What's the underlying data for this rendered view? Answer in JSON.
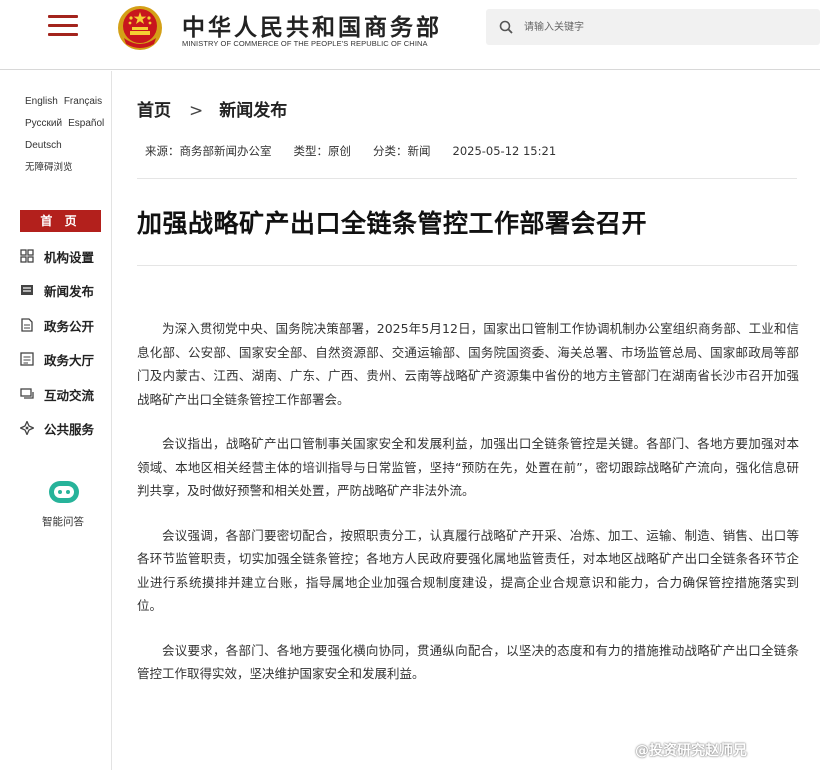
{
  "header": {
    "site_title": "中华人民共和国商务部",
    "site_subtitle": "MINISTRY OF COMMERCE OF THE PEOPLE'S REPUBLIC OF CHINA",
    "search_placeholder": "请输入关键字",
    "menu_icon": "hamburger-menu-icon",
    "emblem_icon": "national-emblem-icon",
    "search_icon": "search-icon"
  },
  "sidebar": {
    "languages": [
      "English",
      "Français",
      "Русский",
      "Español",
      "Deutsch",
      "无障碍浏览"
    ],
    "home": "首 页",
    "nav": [
      {
        "label": "机构设置",
        "icon": "grid-icon"
      },
      {
        "label": "新闻发布",
        "icon": "news-icon"
      },
      {
        "label": "政务公开",
        "icon": "document-icon"
      },
      {
        "label": "政务大厅",
        "icon": "hall-icon"
      },
      {
        "label": "互动交流",
        "icon": "chat-icon"
      },
      {
        "label": "公共服务",
        "icon": "service-icon"
      }
    ],
    "ai_label": "智能问答",
    "ai_icon": "robot-icon"
  },
  "breadcrumb": {
    "home": "首页",
    "sep": ">",
    "current": "新闻发布"
  },
  "meta": {
    "source": "来源：商务部新闻办公室",
    "type": "类型：原创",
    "category": "分类：新闻",
    "datetime": "2025-05-12 15:21"
  },
  "article": {
    "title": "加强战略矿产出口全链条管控工作部署会召开",
    "paragraphs": [
      "为深入贯彻党中央、国务院决策部署，2025年5月12日，国家出口管制工作协调机制办公室组织商务部、工业和信息化部、公安部、国家安全部、自然资源部、交通运输部、国务院国资委、海关总署、市场监管总局、国家邮政局等部门及内蒙古、江西、湖南、广东、广西、贵州、云南等战略矿产资源集中省份的地方主管部门在湖南省长沙市召开加强战略矿产出口全链条管控工作部署会。",
      "会议指出，战略矿产出口管制事关国家安全和发展利益，加强出口全链条管控是关键。各部门、各地方要加强对本领域、本地区相关经营主体的培训指导与日常监管，坚持“预防在先，处置在前”，密切跟踪战略矿产流向，强化信息研判共享，及时做好预警和相关处置，严防战略矿产非法外流。",
      "会议强调，各部门要密切配合，按照职责分工，认真履行战略矿产开采、冶炼、加工、运输、制造、销售、出口等各环节监管职责，切实加强全链条管控；各地方人民政府要强化属地监管责任，对本地区战略矿产出口全链条各环节企业进行系统摸排并建立台账，指导属地企业加强合规制度建设，提高企业合规意识和能力，合力确保管控措施落实到位。",
      "会议要求，各部门、各地方要强化横向协同，贯通纵向配合，以坚决的态度和有力的措施推动战略矿产出口全链条管控工作取得实效，坚决维护国家安全和发展利益。"
    ]
  },
  "watermark": {
    "text": "@投资研究赵师兄",
    "icon": "weibo-icon"
  },
  "colors": {
    "brand_red": "#b3201c",
    "text": "#333333"
  }
}
